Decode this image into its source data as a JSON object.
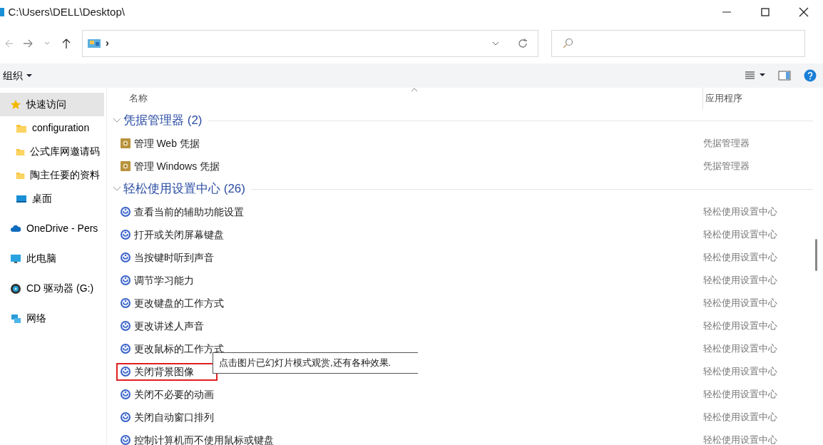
{
  "window": {
    "title": "C:\\Users\\DELL\\Desktop\\"
  },
  "address": {
    "separator": "›"
  },
  "toolbar": {
    "organize": "组织"
  },
  "sidebar": {
    "items": [
      {
        "label": "快速访问",
        "kind": "star",
        "selected": true,
        "children": [
          {
            "label": "configuration",
            "kind": "folder",
            "selected": false
          },
          {
            "label": "公式库网邀请码",
            "kind": "folder",
            "selected": false
          },
          {
            "label": "陶主任要的资料",
            "kind": "folder",
            "selected": false
          },
          {
            "label": "桌面",
            "kind": "desktop",
            "selected": false
          }
        ]
      },
      {
        "label": "OneDrive - Pers",
        "kind": "cloud",
        "selected": false
      },
      {
        "label": "此电脑",
        "kind": "computer",
        "selected": false
      },
      {
        "label": "CD 驱动器 (G:)",
        "kind": "disc",
        "selected": false
      },
      {
        "label": "网络",
        "kind": "network",
        "selected": false
      }
    ]
  },
  "list": {
    "columns": [
      "名称",
      "应用程序"
    ],
    "groups": [
      {
        "title": "凭据管理器 (2)",
        "expanded": true,
        "items": [
          {
            "name": "管理 Web 凭据",
            "app": "凭据管理器",
            "kind": "credential",
            "outlined": false
          },
          {
            "name": "管理 Windows 凭据",
            "app": "凭据管理器",
            "kind": "credential",
            "outlined": false
          }
        ]
      },
      {
        "title": "轻松使用设置中心 (26)",
        "expanded": true,
        "items": [
          {
            "name": "查看当前的辅助功能设置",
            "app": "轻松使用设置中心",
            "kind": "ease",
            "outlined": false
          },
          {
            "name": "打开或关闭屏幕键盘",
            "app": "轻松使用设置中心",
            "kind": "ease",
            "outlined": false
          },
          {
            "name": "当按键时听到声音",
            "app": "轻松使用设置中心",
            "kind": "ease",
            "outlined": false
          },
          {
            "name": "调节学习能力",
            "app": "轻松使用设置中心",
            "kind": "ease",
            "outlined": false
          },
          {
            "name": "更改键盘的工作方式",
            "app": "轻松使用设置中心",
            "kind": "ease",
            "outlined": false
          },
          {
            "name": "更改讲述人声音",
            "app": "轻松使用设置中心",
            "kind": "ease",
            "outlined": false
          },
          {
            "name": "更改鼠标的工作方式",
            "app": "轻松使用设置中心",
            "kind": "ease",
            "outlined": false
          },
          {
            "name": "关闭背景图像",
            "app": "轻松使用设置中心",
            "kind": "ease",
            "outlined": true
          },
          {
            "name": "关闭不必要的动画",
            "app": "轻松使用设置中心",
            "kind": "ease",
            "outlined": false
          },
          {
            "name": "关闭自动窗口排列",
            "app": "轻松使用设置中心",
            "kind": "ease",
            "outlined": false
          },
          {
            "name": "控制计算机而不使用鼠标或键盘",
            "app": "轻松使用设置中心",
            "kind": "ease",
            "outlined": false
          }
        ]
      }
    ]
  },
  "tooltip": {
    "text": "点击图片已幻灯片模式观赏,还有各种效果."
  }
}
